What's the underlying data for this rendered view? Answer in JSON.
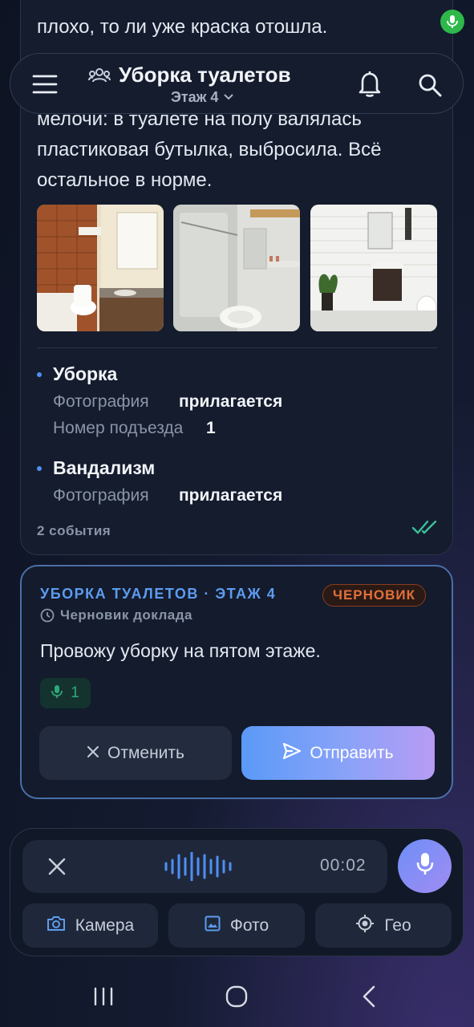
{
  "header": {
    "title": "Уборка туалетов",
    "subtitle": "Этаж 4"
  },
  "message": {
    "text_top_1": "плохо, то ли уже краска отошла.",
    "text_lines": [
      "мелочи: в туалете на полу валялась",
      "пластиковая бутылка, выбросила. Всё",
      "остальное в норме."
    ],
    "events": [
      {
        "title": "Уборка",
        "fields": [
          {
            "key": "Фотография",
            "value": "прилагается"
          },
          {
            "key": "Номер подъезда",
            "value": "1"
          }
        ]
      },
      {
        "title": "Вандализм",
        "fields": [
          {
            "key": "Фотография",
            "value": "прилагается"
          }
        ]
      }
    ],
    "events_count": "2 события"
  },
  "draft": {
    "title": "УБОРКА ТУАЛЕТОВ · ЭТАЖ 4",
    "badge": "ЧЕРНОВИК",
    "meta": "Черновик доклада",
    "text": "Провожу уборку на пятом этаже.",
    "voice_count": "1",
    "cancel_label": "Отменить",
    "send_label": "Отправить"
  },
  "composer": {
    "timer": "00:02",
    "chips": [
      "Камера",
      "Фото",
      "Гео"
    ]
  },
  "colors": {
    "accent": "#5d9cf0",
    "draft_badge": "#e2703a",
    "read_check": "#3bbf9a",
    "recording_indicator": "#2eb84a"
  }
}
